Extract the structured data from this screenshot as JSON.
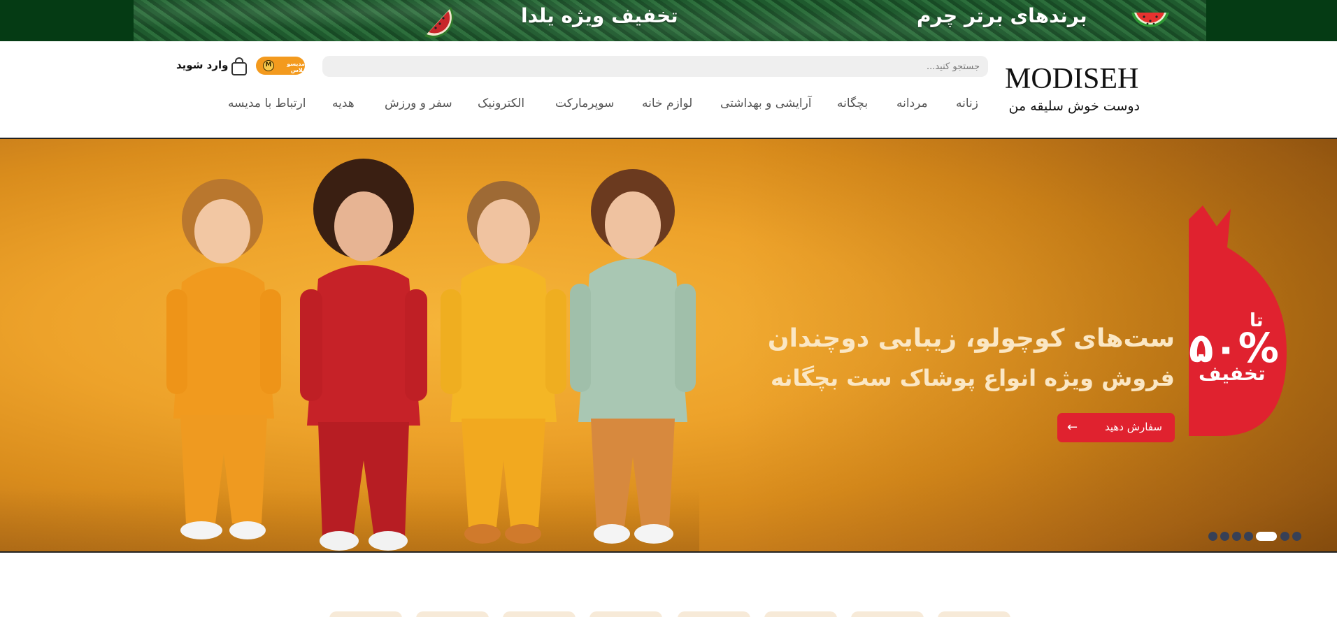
{
  "promo": {
    "right_text": "برندهای برتر چرم",
    "left_text": "تخفیف ویژه یلدا"
  },
  "header": {
    "logo_text": "MODISEH",
    "tagline": "دوست خوش سلیقه من",
    "search": {
      "placeholder": "جستجو کنید..."
    },
    "badge_text": "مدیسو پلاس",
    "badge_coin": "M",
    "login_label": "وارد شوید"
  },
  "nav": {
    "items": [
      {
        "label": "زنانه"
      },
      {
        "label": "مردانه"
      },
      {
        "label": "بچگانه"
      },
      {
        "label": "آرایشی و بهداشتی"
      },
      {
        "label": "لوازم خانه"
      },
      {
        "label": "سوپرمارکت"
      },
      {
        "label": "الکترونیک"
      },
      {
        "label": "سفر و ورزش"
      },
      {
        "label": "هدیه"
      },
      {
        "label": "ارتباط با مدیسه"
      }
    ]
  },
  "hero": {
    "title": "ست‌های کوچولو، زیبایی دوچندان",
    "subtitle": "فروش ویژه انواع پوشاک ست بچگانه",
    "button_label": "سفارش دهید",
    "discount_prefix": "تا",
    "discount_percent": "۵۰%",
    "discount_word": "تخفیف",
    "slides_count": 7,
    "active_slide": 3
  },
  "colors": {
    "promo_bg": "#053b14",
    "accent_red": "#e0222f",
    "badge_orange": "#f39a1e",
    "hero_yellow": "#eda22a"
  }
}
